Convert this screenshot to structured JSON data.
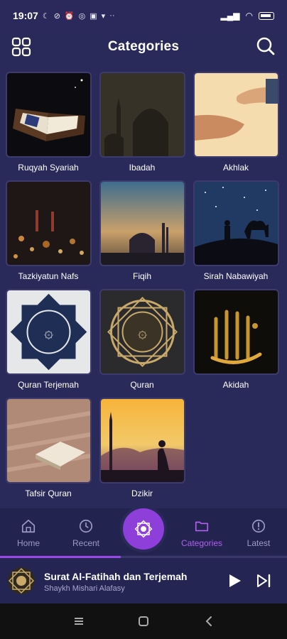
{
  "status_bar": {
    "time": "19:07",
    "icons": [
      "moon-icon",
      "no-vpn-icon",
      "alarm-icon",
      "instagram-icon",
      "linkedin-icon",
      "chat-icon",
      "more-dots"
    ],
    "battery": "battery-icon"
  },
  "app_bar": {
    "title": "Categories"
  },
  "categories": [
    {
      "label": "Ruqyah Syariah"
    },
    {
      "label": "Ibadah"
    },
    {
      "label": "Akhlak"
    },
    {
      "label": "Tazkiyatun Nafs"
    },
    {
      "label": "Fiqih"
    },
    {
      "label": "Sirah Nabawiyah"
    },
    {
      "label": "Quran Terjemah"
    },
    {
      "label": "Quran"
    },
    {
      "label": "Akidah"
    },
    {
      "label": "Tafsir Quran"
    },
    {
      "label": "Dzikir"
    }
  ],
  "bottom_nav": {
    "items": [
      {
        "label": "Home",
        "icon": "home-icon"
      },
      {
        "label": "Recent",
        "icon": "history-icon"
      },
      {
        "label": "Categories",
        "icon": "folder-icon"
      },
      {
        "label": "Latest",
        "icon": "info-icon"
      }
    ],
    "active": "Categories",
    "accent_color": "#b15ff0"
  },
  "player": {
    "title": "Surat Al-Fatihah dan Terjemah",
    "artist": "Shaykh Mishari Alafasy",
    "progress": 0.42
  }
}
